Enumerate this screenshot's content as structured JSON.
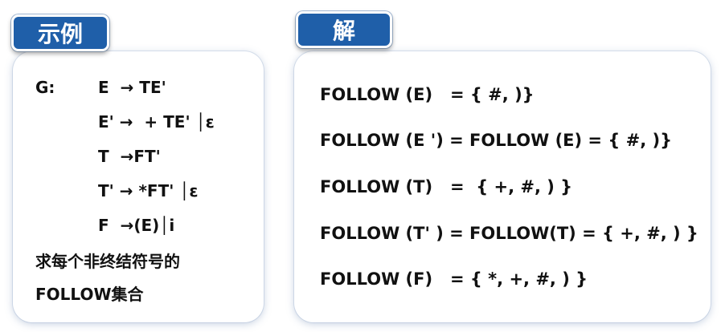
{
  "example": {
    "title": "示例",
    "grammar_label": "G:",
    "productions": [
      "E  → TE'",
      "E' →  + TE' │ε",
      "T  →FT'",
      "T' → *FT' │ε",
      "F  →(E)│i"
    ],
    "question_line1": "求每个非终结符号的",
    "question_line2": "FOLLOW集合"
  },
  "solution": {
    "title": "解",
    "lines": [
      "FOLLOW (E)   = { #, )}",
      "FOLLOW (E ') = FOLLOW (E) = { #, )}",
      "FOLLOW (T)   =  { +, #, ) }",
      "FOLLOW (T' ) = FOLLOW(T) = { +, #, ) }",
      "FOLLOW (F)   = { *, +, #, ) }"
    ]
  },
  "colors": {
    "tag_bg": "#1f5fa9",
    "tag_text": "#ffffff",
    "panel_bg": "#ffffff",
    "text": "#111111"
  }
}
